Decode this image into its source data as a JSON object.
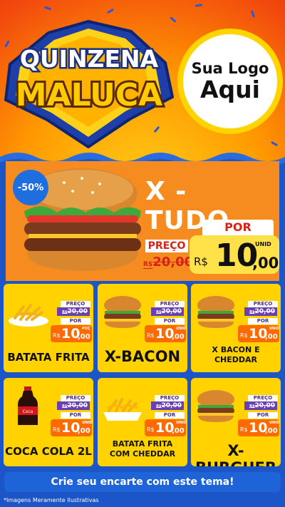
{
  "header": {
    "title_line1": "QUINZENA",
    "title_line2": "MALUCA",
    "logo_line1": "Sua Logo",
    "logo_line2": "Aqui"
  },
  "featured": {
    "discount": "-50%",
    "name": "X - TUDO",
    "preco_label": "PREÇO",
    "old_currency": "R$",
    "old_int": "20",
    "old_dec": ",00",
    "por_label": "POR",
    "currency": "R$",
    "price_int": "10",
    "price_dec": ",00",
    "unit": "UNID"
  },
  "price_labels": {
    "preco": "PREÇO",
    "por": "POR",
    "currency": "R$",
    "old_int": "20",
    "old_dec": ",00",
    "int": "10",
    "dec": ",00"
  },
  "products": [
    {
      "name": "BATATA FRITA",
      "unit": "POÇ",
      "icon": "fries-icon"
    },
    {
      "name": "X-BACON",
      "unit": "UNID",
      "icon": "burger-icon"
    },
    {
      "name": "X BACON E CHEDDAR",
      "unit": "UNID",
      "icon": "burger-icon"
    },
    {
      "name": "COCA COLA 2L",
      "unit": "UNID",
      "icon": "soda-bottle-icon"
    },
    {
      "name": "BATATA FRITA COM CHEDDAR",
      "unit": "UNID",
      "icon": "fries-cheddar-icon"
    },
    {
      "name": "X-BURGUER",
      "unit": "UNID",
      "icon": "burger-icon"
    }
  ],
  "footer": {
    "cta": "Crie seu encarte com este tema!",
    "disclaimer": "*Imagens Meramente Ilustrativas"
  },
  "colors": {
    "orange": "#f68c1f",
    "yellow": "#ffd200",
    "blue": "#1f63d8",
    "red": "#d82217",
    "purple": "#6a3fb1"
  }
}
